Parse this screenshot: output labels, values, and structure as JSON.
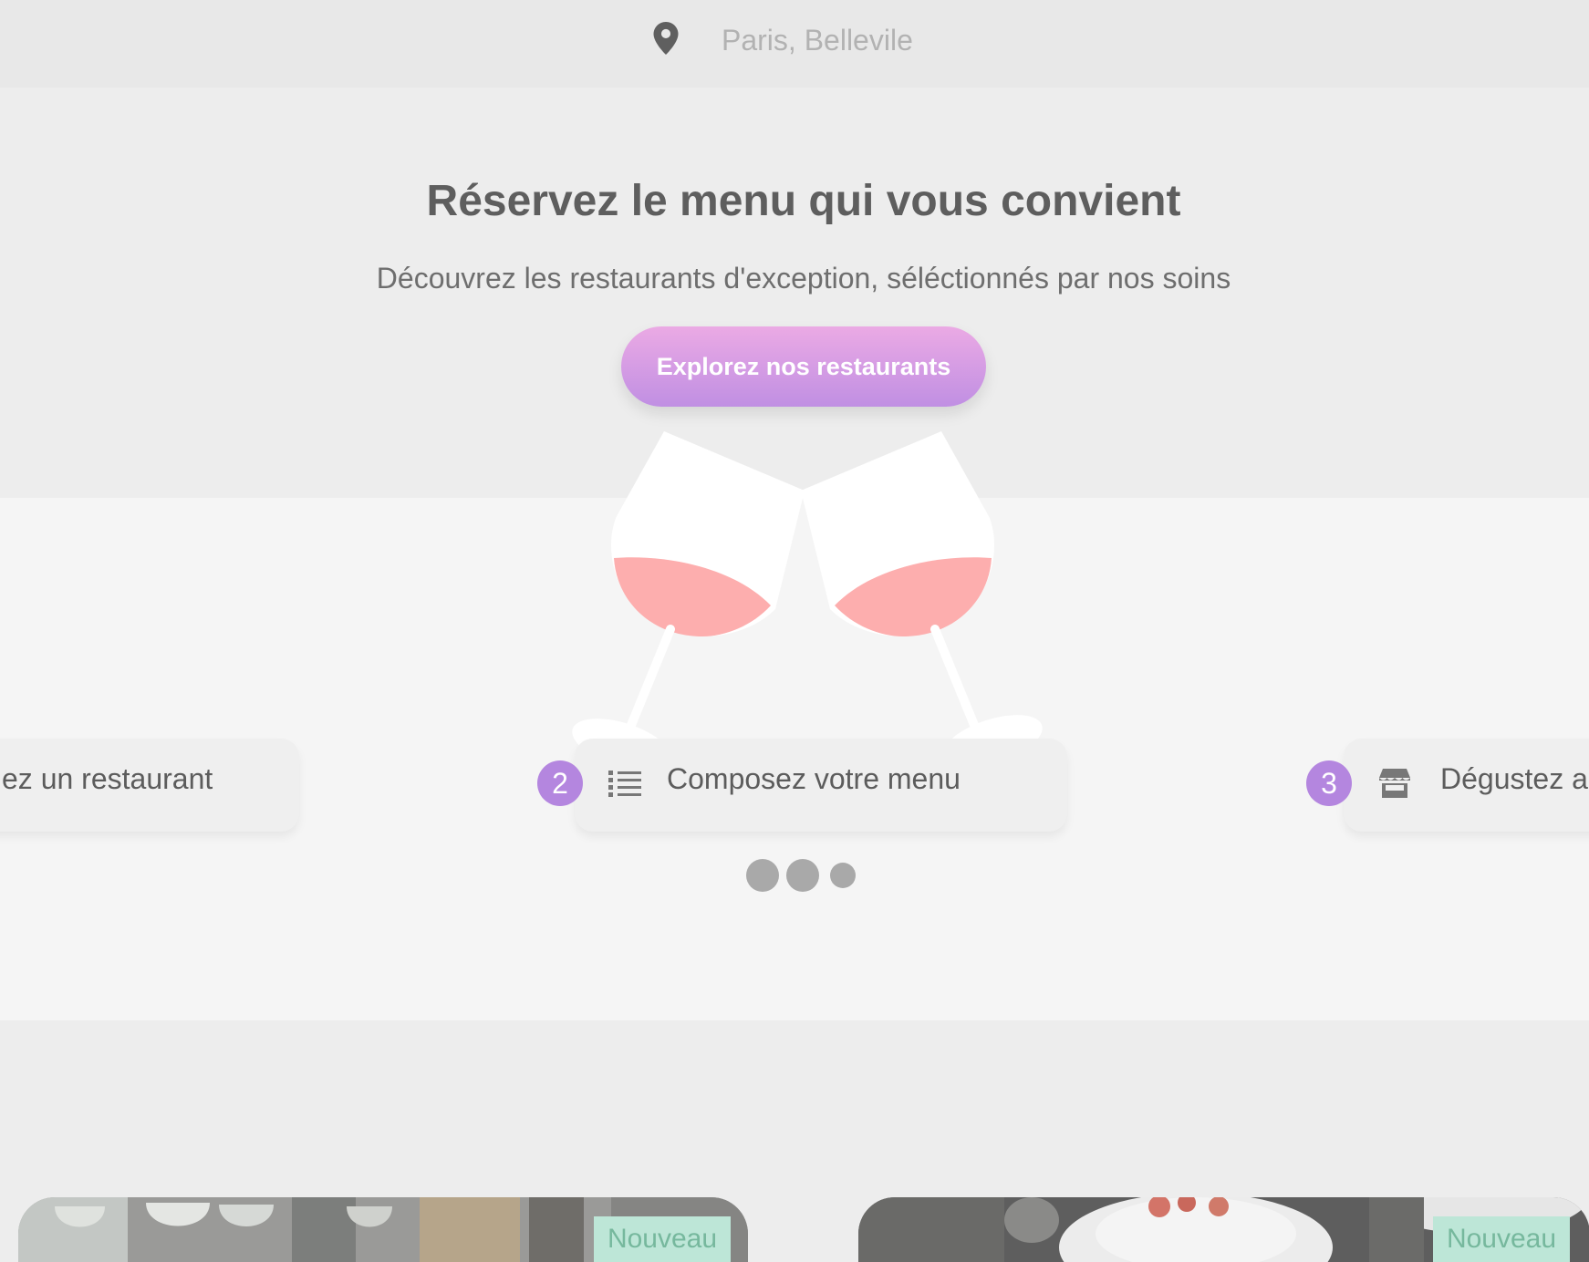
{
  "location": {
    "icon": "map-pin-icon",
    "text": "Paris, Bellevile"
  },
  "hero": {
    "title": "Réservez le menu qui vous convient",
    "subtitle": "Découvrez les restaurants d'exception, séléctionnés par nos soins",
    "cta_label": "Explorez nos restaurants"
  },
  "steps": [
    {
      "number": "",
      "icon": "search-icon",
      "label": "ez un restaurant"
    },
    {
      "number": "2",
      "icon": "list-icon",
      "label": "Composez votre menu"
    },
    {
      "number": "3",
      "icon": "store-icon",
      "label": "Dégustez au"
    }
  ],
  "carousel": {
    "dots": 3,
    "active_index": 2
  },
  "cards": [
    {
      "badge": "Nouveau",
      "image": "wine-glasses-photo"
    },
    {
      "badge": "Nouveau",
      "image": "dishes-table-photo"
    }
  ],
  "colors": {
    "accent_purple": "#b486df",
    "cta_gradient_top": "#ebaae4",
    "cta_gradient_bottom": "#c08fe3",
    "badge_bg": "#bde6d7",
    "badge_text": "#76b89d",
    "wine": "#fdaeae"
  }
}
